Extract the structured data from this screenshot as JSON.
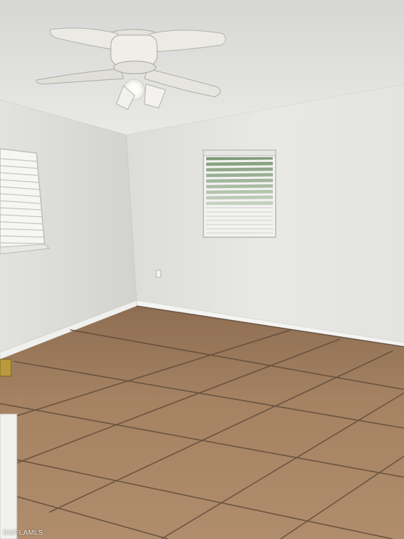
{
  "scene": {
    "description_name": "empty-bedroom",
    "colors": {
      "ceiling": "#e4e4e2",
      "wall_back": "#e6e6e3",
      "wall_left": "#d8d8d4",
      "baseboard": "#f2f2f0",
      "tile": "#a07e5f",
      "grout": "#5e4a39",
      "blind": "#f1f1ef",
      "fan_blade": "#ecebe6"
    },
    "watermark": "SWFLAMLS"
  }
}
